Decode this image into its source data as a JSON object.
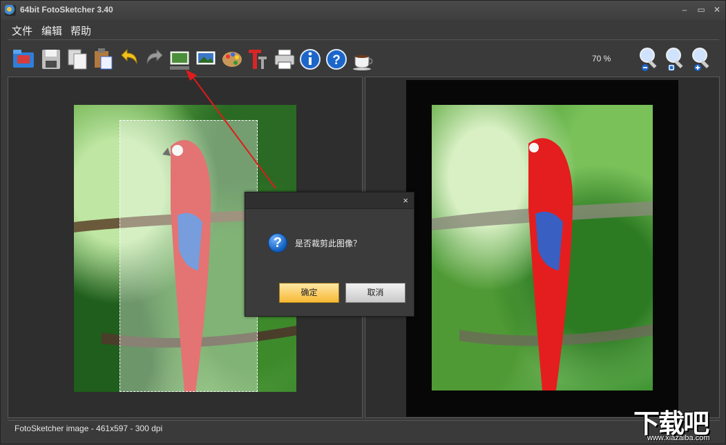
{
  "window": {
    "title": "64bit FotoSketcher 3.40"
  },
  "menu": {
    "items": [
      "文件",
      "编辑",
      "帮助"
    ]
  },
  "toolbar": {
    "zoom_level": "70 %",
    "buttons": [
      {
        "name": "open-folder-icon"
      },
      {
        "name": "save-icon"
      },
      {
        "name": "copy-icon"
      },
      {
        "name": "paste-icon"
      },
      {
        "name": "undo-icon"
      },
      {
        "name": "redo-icon"
      },
      {
        "name": "crop-icon"
      },
      {
        "name": "image-icon"
      },
      {
        "name": "palette-icon"
      },
      {
        "name": "text-icon"
      },
      {
        "name": "print-icon"
      },
      {
        "name": "info-icon"
      },
      {
        "name": "help-icon"
      },
      {
        "name": "coffee-icon"
      }
    ],
    "zoom_buttons": [
      {
        "name": "zoom-out-icon"
      },
      {
        "name": "zoom-fit-icon"
      },
      {
        "name": "zoom-in-icon"
      }
    ]
  },
  "dialog": {
    "message": "是否裁剪此图像？",
    "ok_label": "确定",
    "cancel_label": "取消",
    "close_glyph": "×",
    "question_glyph": "?"
  },
  "status": {
    "text": "FotoSketcher image - 461x597 - 300 dpi"
  },
  "watermark": {
    "main": "下载吧",
    "sub": "www.xiazaiba.com"
  },
  "colors": {
    "accent_arrow": "#e01b1b",
    "ok_button": "#f8b934",
    "panel_bg": "#2e2e2e"
  }
}
